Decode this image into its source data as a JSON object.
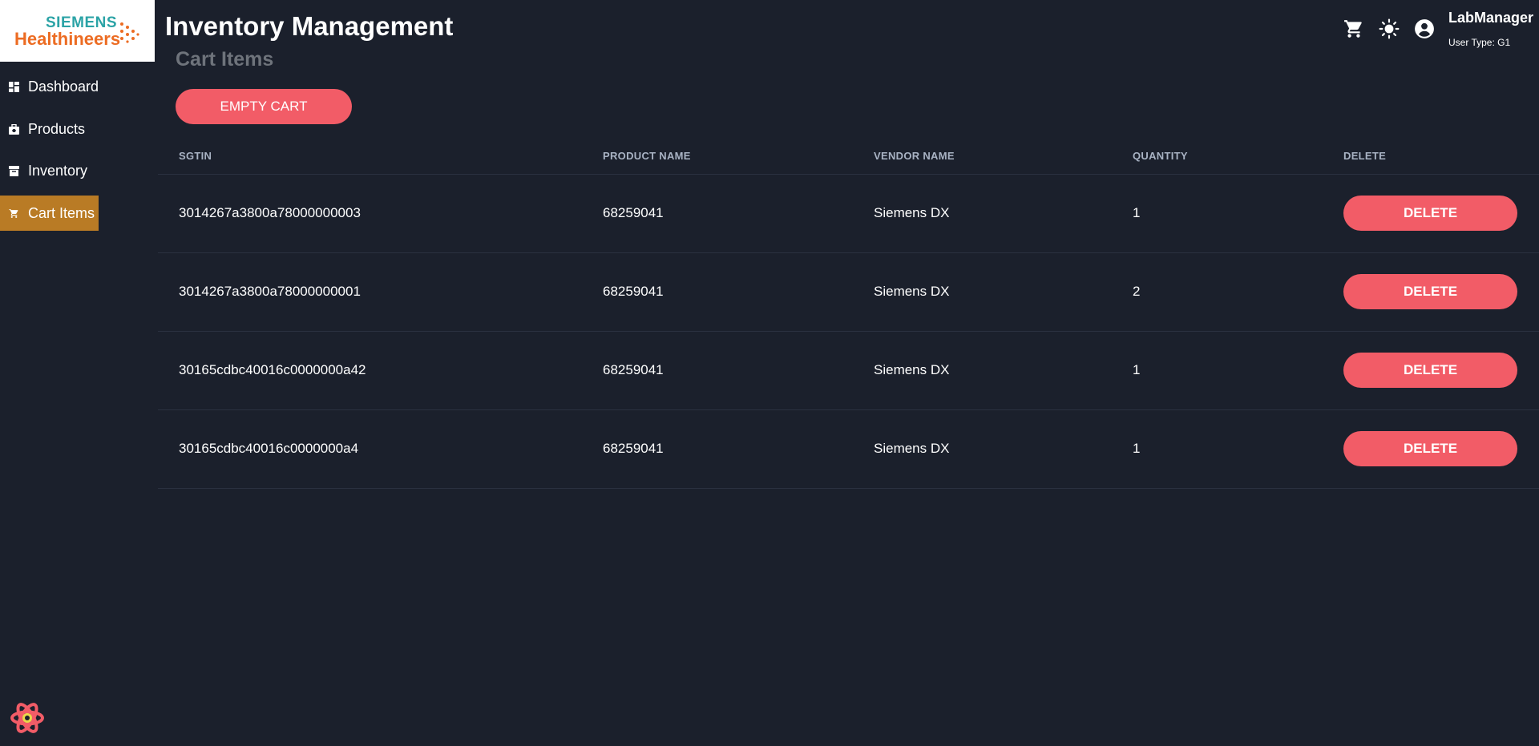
{
  "brand": {
    "line1": "SIEMENS",
    "line2": "Healthineers"
  },
  "sidebar": {
    "items": [
      {
        "label": "Dashboard",
        "icon": "dashboard-icon"
      },
      {
        "label": "Products",
        "icon": "briefcase-icon"
      },
      {
        "label": "Inventory",
        "icon": "archive-icon"
      },
      {
        "label": "Cart Items",
        "icon": "cart-icon",
        "active": true
      }
    ]
  },
  "header": {
    "title": "Inventory Management",
    "user_name": "LabManager",
    "user_type": "User Type: G1",
    "icons": [
      "cart-icon",
      "brightness-icon",
      "account-icon"
    ]
  },
  "main": {
    "section_title": "Cart Items",
    "empty_cart_label": "EMPTY CART",
    "columns": [
      "SGTIN",
      "PRODUCT NAME",
      "VENDOR NAME",
      "QUANTITY",
      "DELETE"
    ],
    "delete_label": "DELETE",
    "rows": [
      {
        "sgtin": "3014267a3800a78000000003",
        "product": "68259041",
        "vendor": "Siemens DX",
        "quantity": "1"
      },
      {
        "sgtin": "3014267a3800a78000000001",
        "product": "68259041",
        "vendor": "Siemens DX",
        "quantity": "2"
      },
      {
        "sgtin": "30165cdbc40016c0000000a42",
        "product": "68259041",
        "vendor": "Siemens DX",
        "quantity": "1"
      },
      {
        "sgtin": "30165cdbc40016c0000000a4",
        "product": "68259041",
        "vendor": "Siemens DX",
        "quantity": "1"
      }
    ]
  },
  "colors": {
    "background": "#1b202c",
    "accent_button": "#f25c67",
    "active_nav": "#b97b25",
    "brand_teal": "#2ba3a6",
    "brand_orange": "#ec6c23"
  }
}
